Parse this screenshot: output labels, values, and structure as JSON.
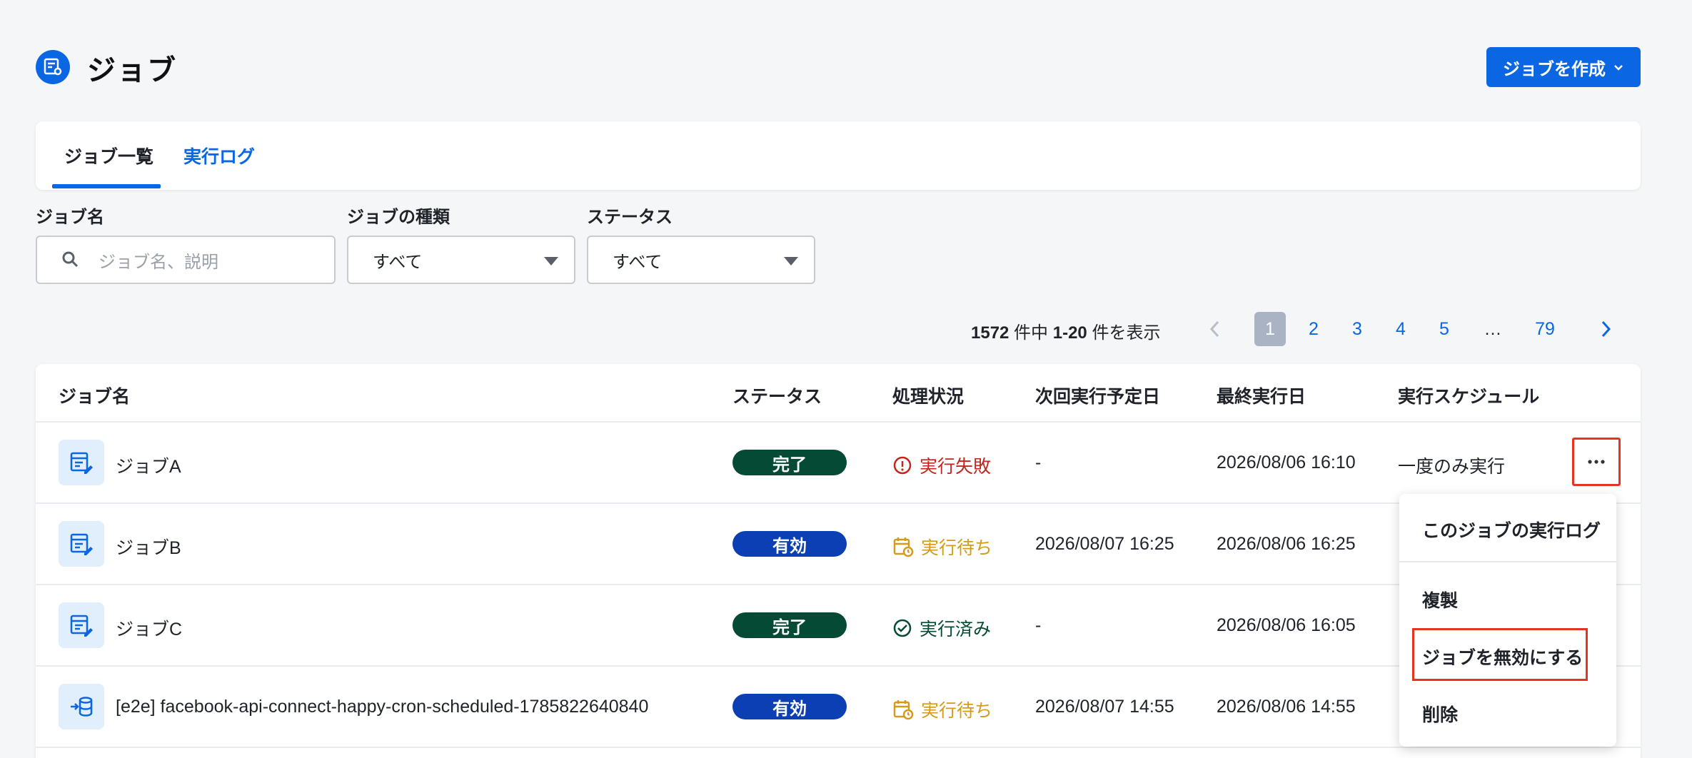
{
  "header": {
    "title": "ジョブ",
    "icon": "job-icon",
    "create_button": "ジョブを作成"
  },
  "tabs": [
    {
      "label": "ジョブ一覧",
      "active": true
    },
    {
      "label": "実行ログ",
      "active": false
    }
  ],
  "filters": {
    "job_name": {
      "label": "ジョブ名",
      "placeholder": "ジョブ名、説明"
    },
    "job_type": {
      "label": "ジョブの種類",
      "value": "すべて"
    },
    "status": {
      "label": "ステータス",
      "value": "すべて"
    }
  },
  "pagination": {
    "total": "1572",
    "total_suffix": " 件中 ",
    "range": "1-20",
    "range_suffix": " 件を表示",
    "pages": [
      "1",
      "2",
      "3",
      "4",
      "5",
      "…",
      "79"
    ],
    "current": "1"
  },
  "table": {
    "columns": [
      "ジョブ名",
      "ステータス",
      "処理状況",
      "次回実行予定日",
      "最終実行日",
      "実行スケジュール"
    ],
    "rows": [
      {
        "name": "ジョブA",
        "icon": "table-edit-icon",
        "status": "完了",
        "status_color": "#054a35",
        "state": "実行失敗",
        "state_color": "#c3261c",
        "state_icon": "error-icon",
        "next_run": "-",
        "last_run": "2026/08/06 16:10",
        "schedule": "一度のみ実行"
      },
      {
        "name": "ジョブB",
        "icon": "table-edit-icon",
        "status": "有効",
        "status_color": "#0b3fb3",
        "state": "実行待ち",
        "state_color": "#d39b1b",
        "state_icon": "calendar-clock-icon",
        "next_run": "2026/08/07 16:25",
        "last_run": "2026/08/06 16:25",
        "schedule": ""
      },
      {
        "name": "ジョブC",
        "icon": "table-edit-icon",
        "status": "完了",
        "status_color": "#054a35",
        "state": "実行済み",
        "state_color": "#054a35",
        "state_icon": "check-circle-icon",
        "next_run": "-",
        "last_run": "2026/08/06 16:05",
        "schedule": ""
      },
      {
        "name": "[e2e] facebook-api-connect-happy-cron-scheduled-1785822640840",
        "icon": "import-database-icon",
        "status": "有効",
        "status_color": "#0b3fb3",
        "state": "実行待ち",
        "state_color": "#d39b1b",
        "state_icon": "calendar-clock-icon",
        "next_run": "2026/08/07 14:55",
        "last_run": "2026/08/06 14:55",
        "schedule": ""
      }
    ]
  },
  "row_menu": {
    "items": [
      "このジョブの実行ログ",
      "複製",
      "ジョブを無効にする",
      "削除"
    ]
  },
  "colors": {
    "accent": "#0b66e4",
    "highlight": "#e53522"
  }
}
